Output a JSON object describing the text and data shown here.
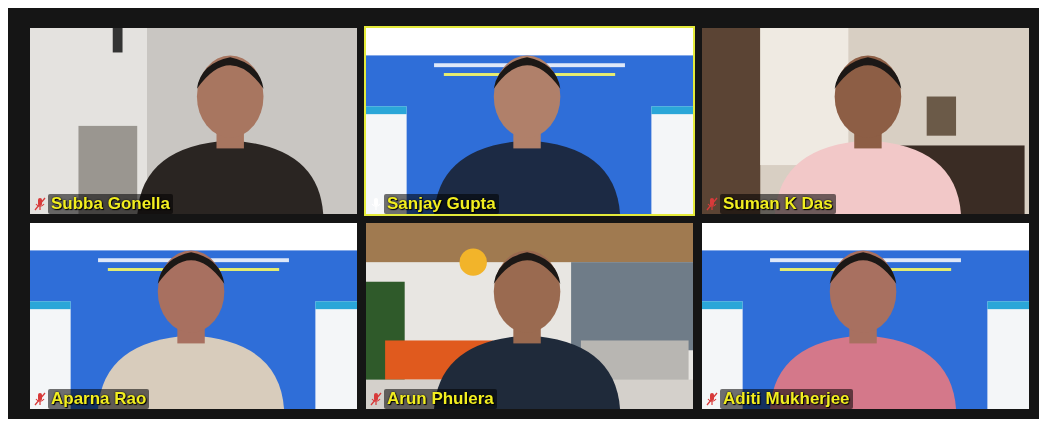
{
  "tiles": [
    {
      "name": "Subba Gonella",
      "speaking": false,
      "muted": true
    },
    {
      "name": "Sanjay Gupta",
      "speaking": true,
      "muted": false
    },
    {
      "name": "Suman K Das",
      "speaking": false,
      "muted": true
    },
    {
      "name": "Aparna Rao",
      "speaking": false,
      "muted": true
    },
    {
      "name": "Arun Phulera",
      "speaking": false,
      "muted": true
    },
    {
      "name": "Aditi Mukherjee",
      "speaking": false,
      "muted": true
    }
  ]
}
